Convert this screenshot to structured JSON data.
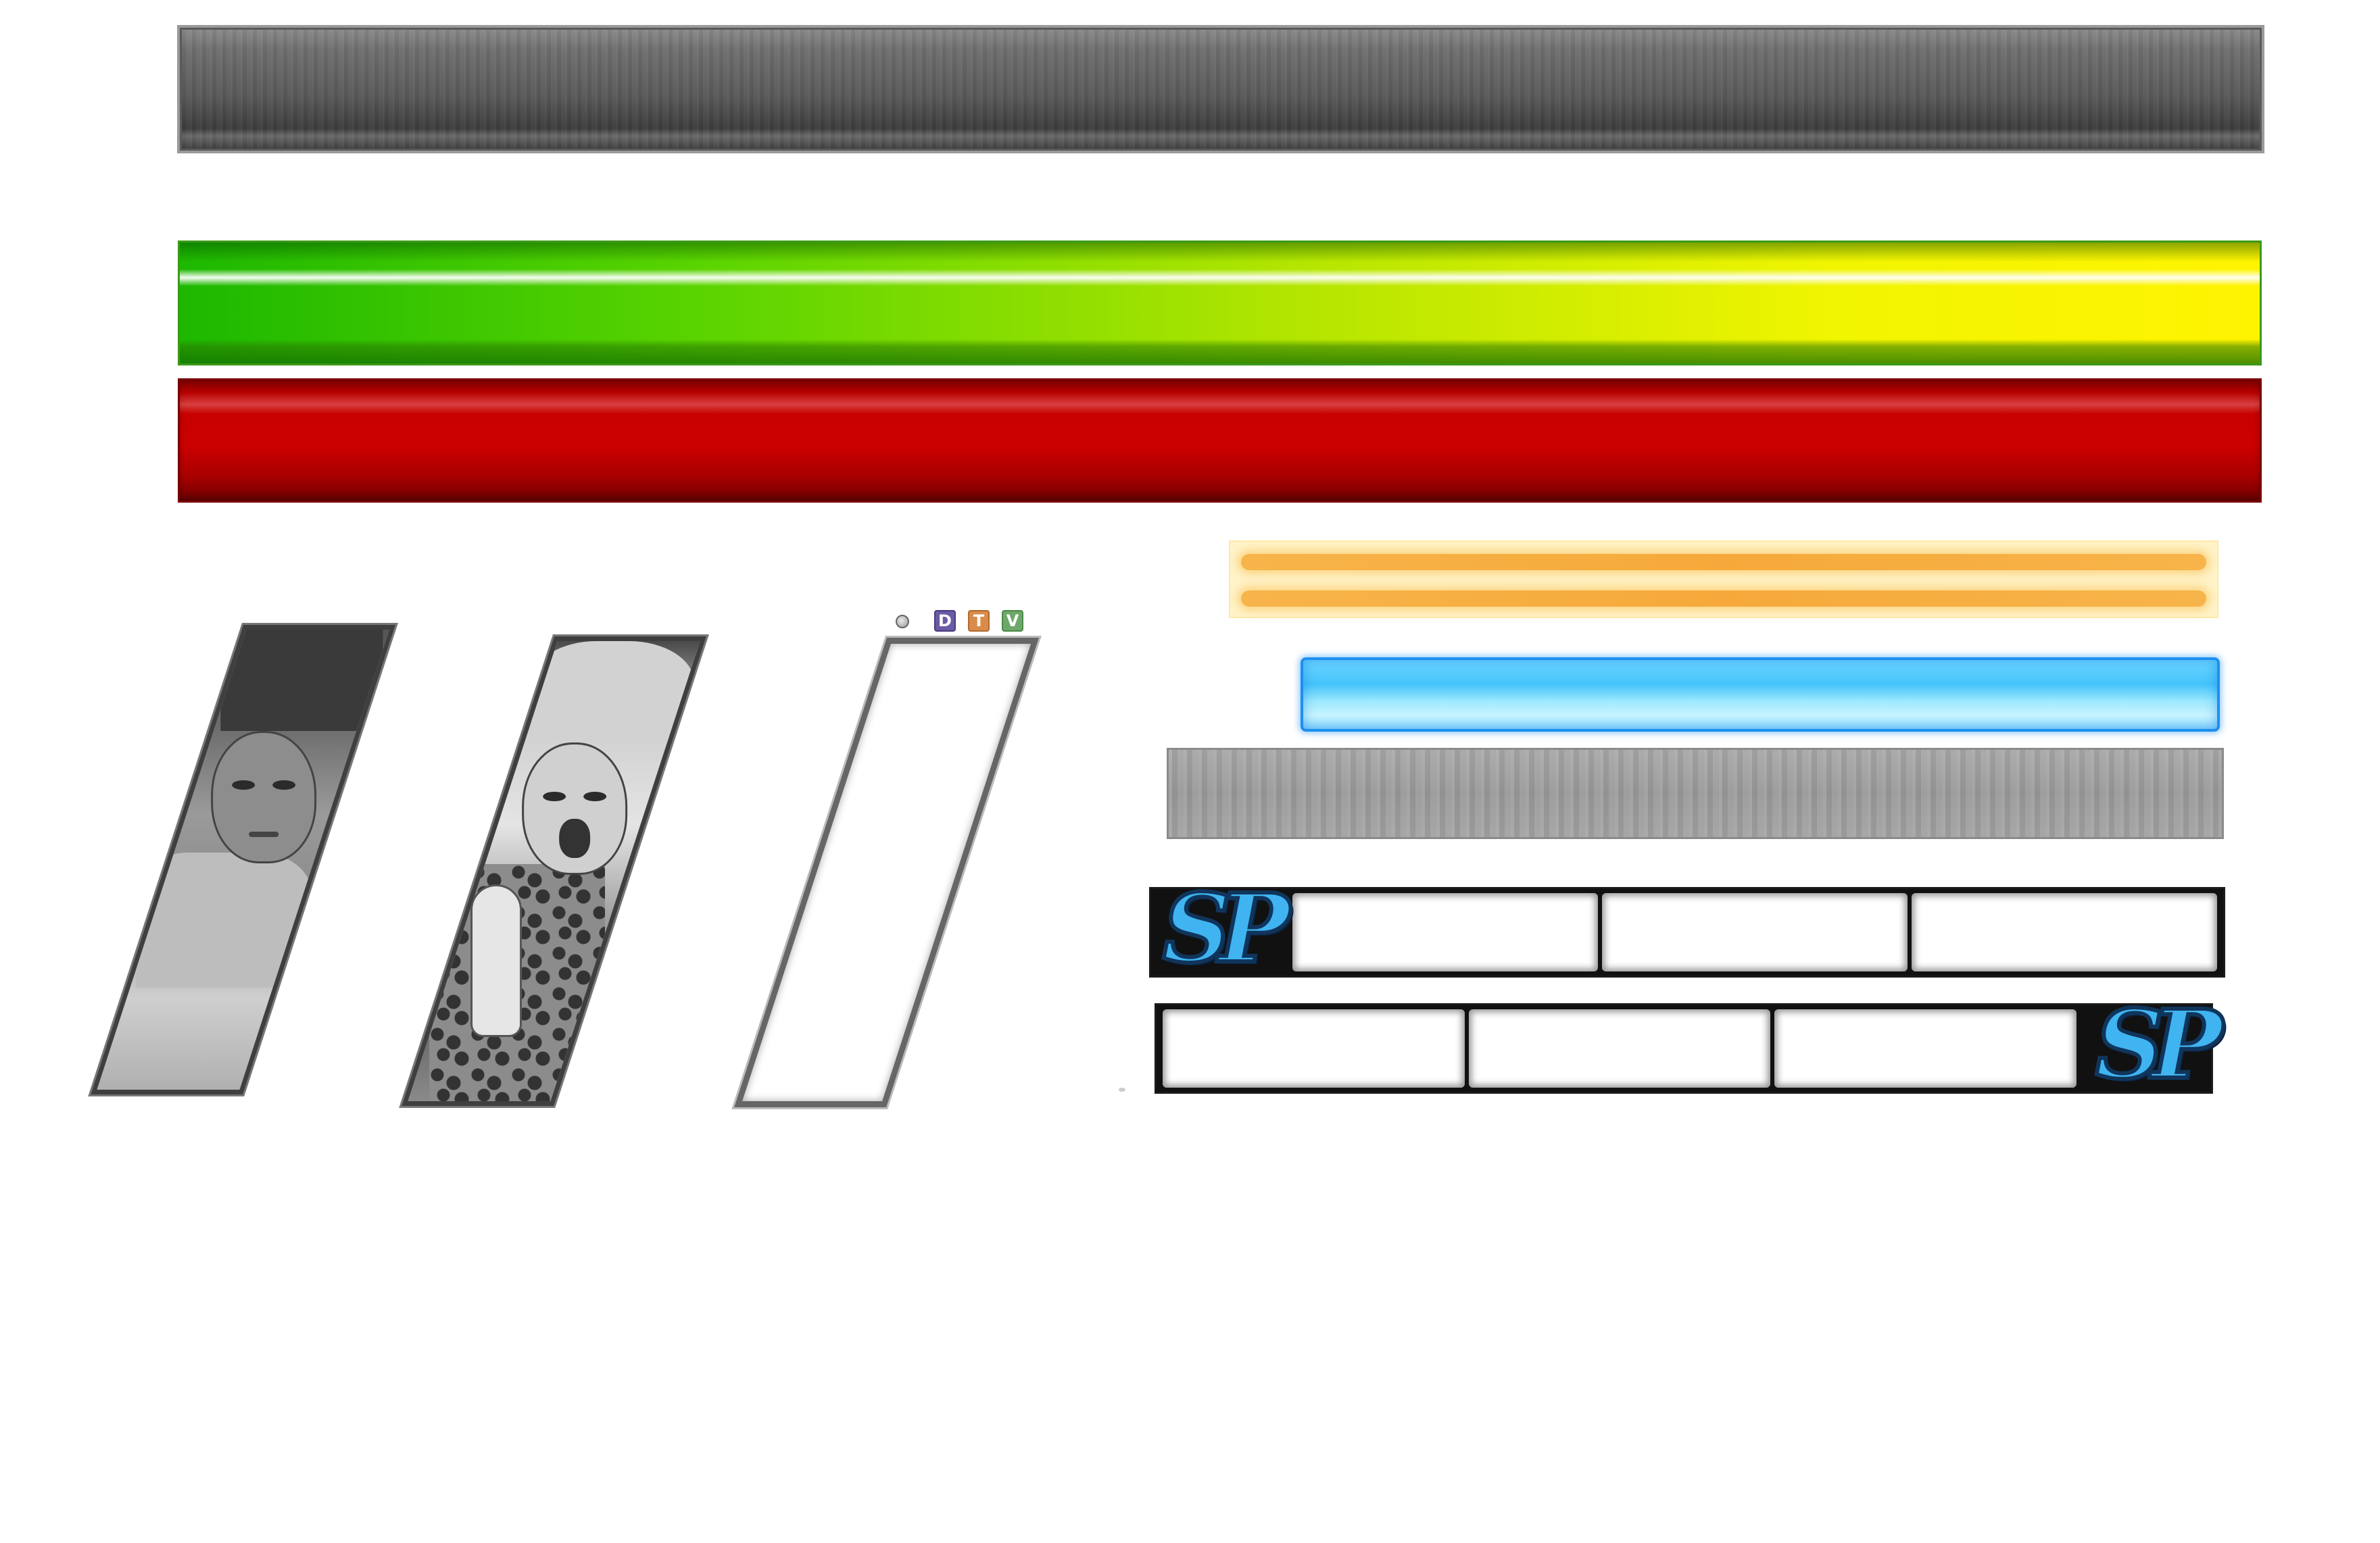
{
  "tools": {
    "dot_icon": "circle-icon",
    "letters": [
      "D",
      "T",
      "V"
    ],
    "colors": {
      "D": "#6b5aa6",
      "T": "#d98c4a",
      "V": "#6da86a"
    }
  },
  "sp_gauges": {
    "left_logo": "SP",
    "right_logo": "SP",
    "logo_color": "#3fb4f0",
    "segments": 3
  },
  "bars": {
    "health_colors": [
      "#1db800",
      "#fff300"
    ],
    "damage_color": "#cc0000",
    "orange_color": "#f6a93a",
    "cyan_color": "#44c3fb",
    "grey_color": "#9b9b9b"
  },
  "portraits": [
    "male-portrait",
    "female-portrait",
    "empty-portrait-frame"
  ]
}
